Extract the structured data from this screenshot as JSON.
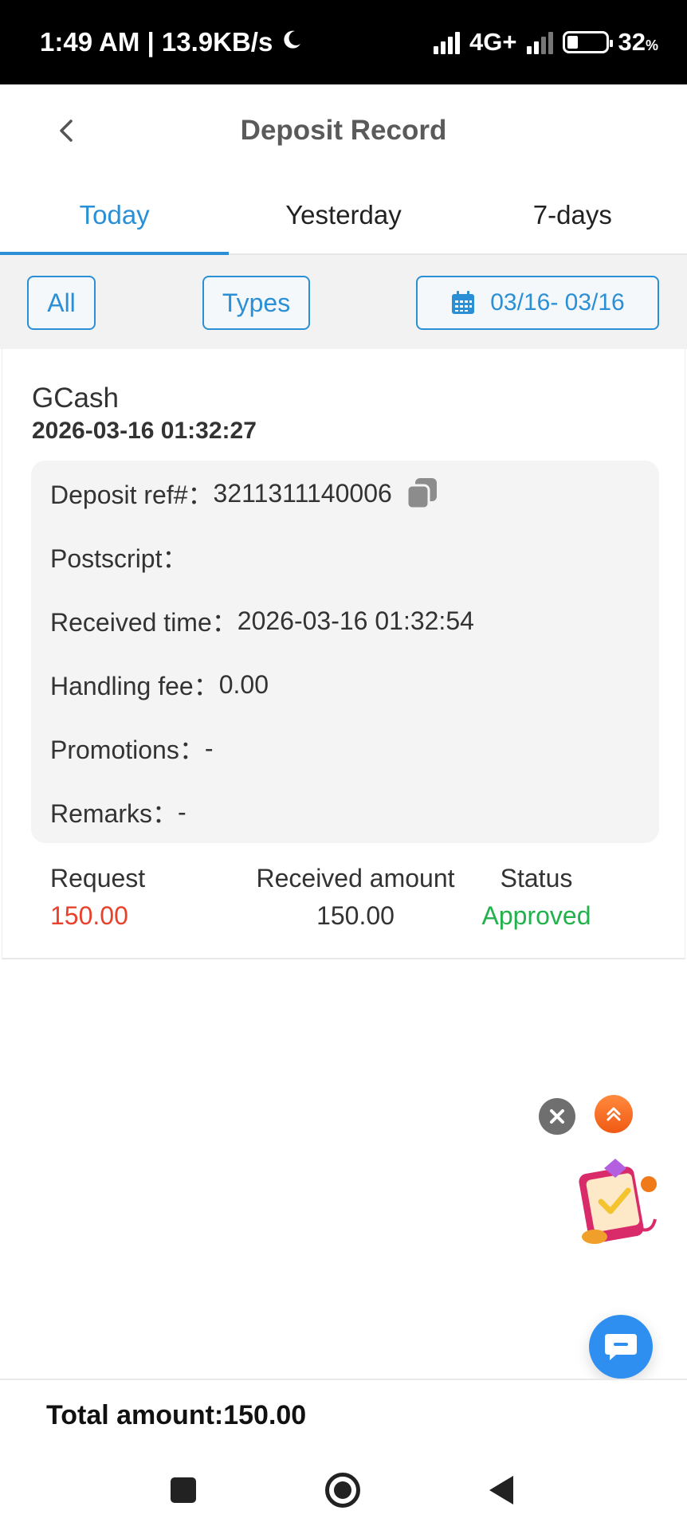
{
  "status_bar": {
    "time_speed": "1:49 AM | 13.9KB/s",
    "network": "4G+",
    "battery_pct": "32",
    "battery_unit": "%"
  },
  "header": {
    "title": "Deposit Record",
    "back_icon": "chevron-left-icon"
  },
  "tabs": [
    {
      "label": "Today",
      "active": true
    },
    {
      "label": "Yesterday",
      "active": false
    },
    {
      "label": "7-days",
      "active": false
    }
  ],
  "filters": {
    "all_label": "All",
    "types_label": "Types",
    "date_range": "03/16- 03/16",
    "date_icon": "calendar-icon"
  },
  "record": {
    "method": "GCash",
    "datetime": "2026-03-16 01:32:27",
    "details": {
      "deposit_ref_label": "Deposit ref#：",
      "deposit_ref_value": "3211311140006",
      "postscript_label": "Postscript：",
      "postscript_value": "",
      "received_time_label": "Received time：",
      "received_time_value": "2026-03-16 01:32:54",
      "handling_fee_label": "Handling fee：",
      "handling_fee_value": "0.00",
      "promotions_label": "Promotions：",
      "promotions_value": "-",
      "remarks_label": "Remarks：",
      "remarks_value": "-"
    },
    "summary": {
      "request_label": "Request",
      "request_value": "150.00",
      "received_label": "Received amount",
      "received_value": "150.00",
      "status_label": "Status",
      "status_value": "Approved"
    }
  },
  "footer": {
    "total_text": "Total amount:150.00"
  },
  "colors": {
    "accent": "#2a8fd4",
    "request_red": "#e8412c",
    "approved_green": "#22b24c",
    "float_orange": "#f05a14",
    "chat_blue": "#2f8ff0"
  }
}
